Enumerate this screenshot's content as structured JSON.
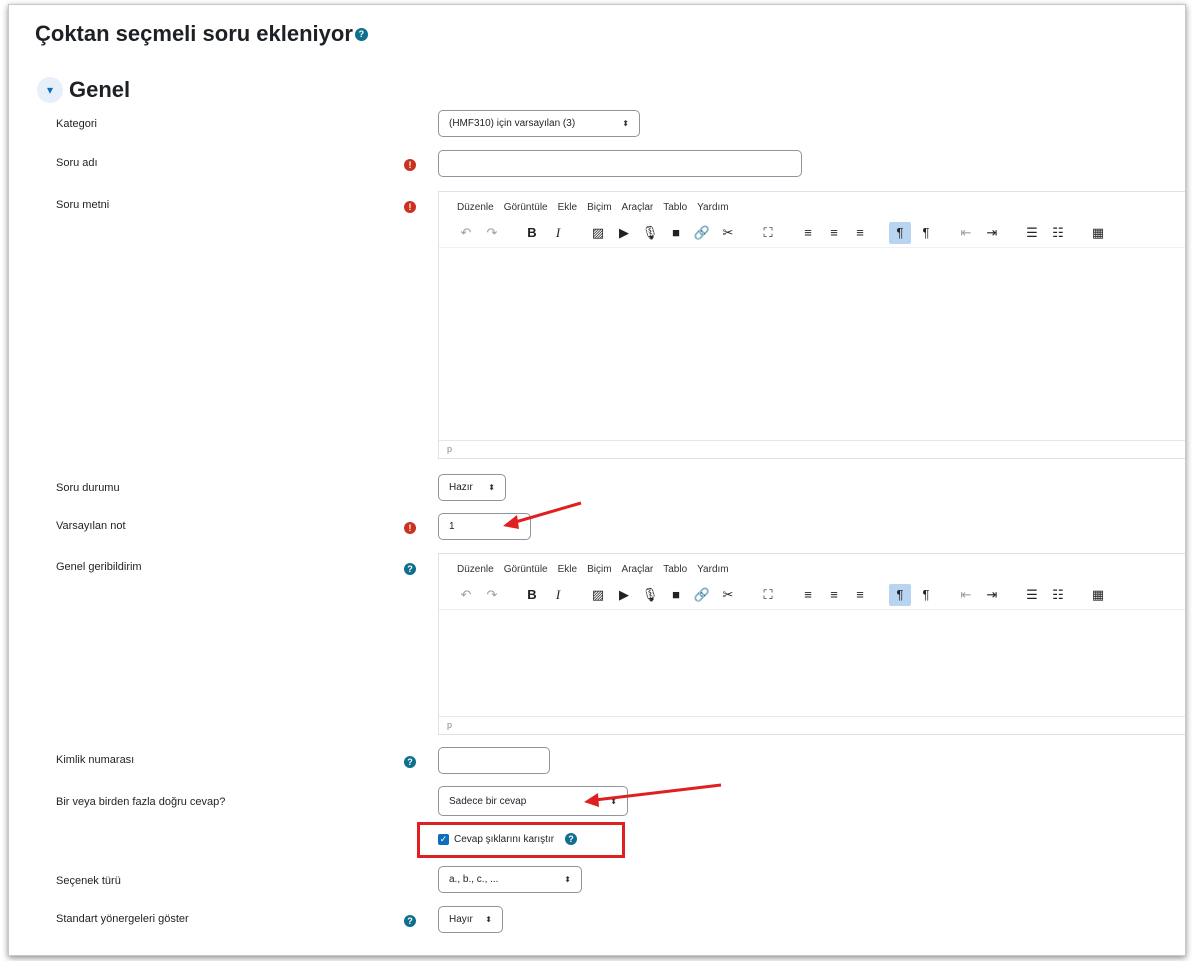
{
  "page": {
    "title": "Çoktan seçmeli soru ekleniyor",
    "title_help": "?"
  },
  "section": {
    "chevron": "⌄",
    "title": "Genel"
  },
  "fields": {
    "kategori": {
      "label": "Kategori",
      "value": "(HMF310) için varsayılan (3)"
    },
    "soru_adi": {
      "label": "Soru adı",
      "value": ""
    },
    "soru_metni": {
      "label": "Soru metni",
      "status_path": "p"
    },
    "soru_durumu": {
      "label": "Soru durumu",
      "value": "Hazır"
    },
    "varsayilan_not": {
      "label": "Varsayılan not",
      "value": "1"
    },
    "genel_geribildirim": {
      "label": "Genel geribildirim",
      "status_path": "p"
    },
    "kimlik_numarasi": {
      "label": "Kimlik numarası",
      "value": ""
    },
    "dogru_cevap": {
      "label": "Bir veya birden fazla doğru cevap?",
      "value": "Sadece bir cevap"
    },
    "karistir": {
      "label": "Cevap şıklarını karıştır",
      "checked": true
    },
    "secenek_turu": {
      "label": "Seçenek türü",
      "value": "a., b., c., ..."
    },
    "standart_yonergeler": {
      "label": "Standart yönergeleri göster",
      "value": "Hayır"
    }
  },
  "editor_menu": [
    "Düzenle",
    "Görüntüle",
    "Ekle",
    "Biçim",
    "Araçlar",
    "Tablo",
    "Yardım"
  ],
  "icons": {
    "required": "!",
    "help": "?",
    "select_caret": "⬍"
  },
  "colors": {
    "primary": "#0f6cbf",
    "required": "#ca3120",
    "help": "#0f6f8f",
    "annotation": "#e02020"
  }
}
